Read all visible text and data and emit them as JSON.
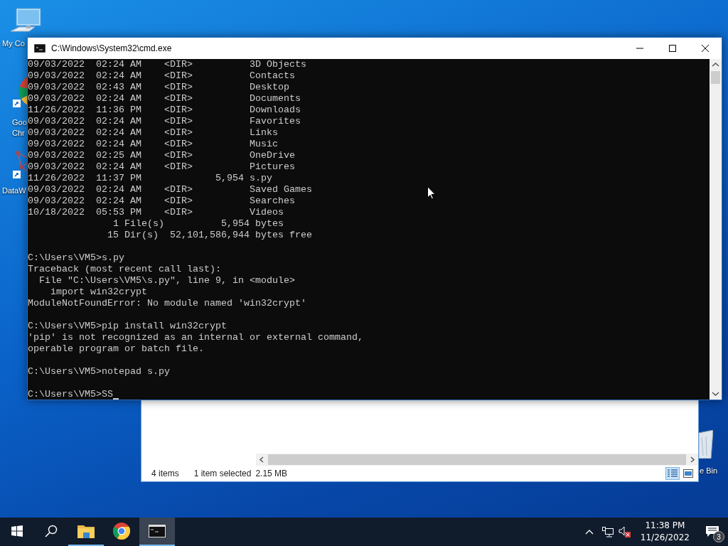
{
  "desktop_icons": [
    {
      "kind": "computer",
      "label": [
        "My Co"
      ]
    },
    {
      "kind": "chrome",
      "label": [
        "Goo",
        "Chr"
      ]
    },
    {
      "kind": "data",
      "label": [
        "DataW"
      ]
    },
    {
      "kind": "recycle",
      "label": [
        "e Bin"
      ]
    }
  ],
  "explorer": {
    "status": [
      "4 items",
      "1 item selected",
      "2.15 MB"
    ],
    "views": [
      {
        "kind": "details",
        "selected": true
      },
      {
        "kind": "large-icons",
        "selected": false
      }
    ]
  },
  "terminal": {
    "title": "C:\\Windows\\System32\\cmd.exe",
    "cursor_visible": true,
    "blocks": [
      [
        "09/03/2022  02:24 AM    <DIR>          3D Objects",
        "09/03/2022  02:24 AM    <DIR>          Contacts",
        "09/03/2022  02:43 AM    <DIR>          Desktop",
        "09/03/2022  02:24 AM    <DIR>          Documents",
        "11/26/2022  11:36 PM    <DIR>          Downloads",
        "09/03/2022  02:24 AM    <DIR>          Favorites",
        "09/03/2022  02:24 AM    <DIR>          Links",
        "09/03/2022  02:24 AM    <DIR>          Music",
        "09/03/2022  02:25 AM    <DIR>          OneDrive",
        "09/03/2022  02:24 AM    <DIR>          Pictures",
        "11/26/2022  11:37 PM             5,954 s.py",
        "09/03/2022  02:24 AM    <DIR>          Saved Games",
        "09/03/2022  02:24 AM    <DIR>          Searches",
        "10/18/2022  05:53 PM    <DIR>          Videos",
        "               1 File(s)          5,954 bytes",
        "              15 Dir(s)  52,101,586,944 bytes free"
      ],
      [
        "C:\\Users\\VM5>s.py",
        "Traceback (most recent call last):",
        "  File \"C:\\Users\\VM5\\s.py\", line 9, in <module>",
        "    import win32crypt",
        "ModuleNotFoundError: No module named 'win32crypt'"
      ],
      [
        "C:\\Users\\VM5>pip install win32crypt",
        "'pip' is not recognized as an internal or external command,",
        "operable program or batch file."
      ],
      [
        "C:\\Users\\VM5>notepad s.py"
      ],
      [
        "C:\\Users\\VM5>SS"
      ]
    ]
  },
  "taskbar": {
    "apps": [
      {
        "kind": "explorer",
        "running": true,
        "selected": false
      },
      {
        "kind": "chrome",
        "running": false,
        "selected": false
      },
      {
        "kind": "terminal",
        "running": true,
        "selected": true
      }
    ],
    "volume_muted": true,
    "clock": {
      "time": "11:38 PM",
      "date": "11/26/2022"
    },
    "notification_count": "3"
  }
}
